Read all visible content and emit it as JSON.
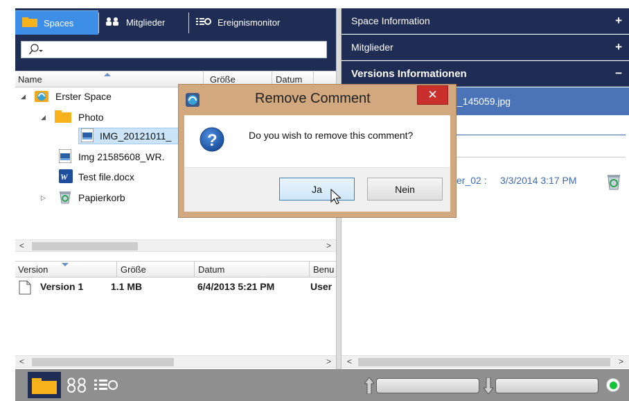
{
  "left_tabs": [
    {
      "label": "Spaces",
      "icon": "folder-icon",
      "active": true
    },
    {
      "label": "Mitglieder",
      "icon": "members-icon",
      "active": false
    },
    {
      "label": "Ereignismonitor",
      "icon": "event-monitor-icon",
      "active": false
    }
  ],
  "search": {
    "placeholder": "",
    "icon": "search-icon"
  },
  "file_columns": [
    "Name",
    "Größe",
    "Datum"
  ],
  "tree": [
    {
      "label": "Erster Space",
      "icon": "space-icon",
      "expanded": true
    },
    {
      "label": "Photo",
      "icon": "folder-icon",
      "expanded": true
    },
    {
      "label": "IMG_20121011_",
      "icon": "image-file-icon",
      "selected": true
    },
    {
      "label": "Img 21585608_WR.",
      "icon": "image-file-icon"
    },
    {
      "label": "Test file.docx",
      "icon": "word-file-icon"
    },
    {
      "label": "Papierkorb",
      "icon": "recycle-bin-icon",
      "expanded": false
    }
  ],
  "version_columns": [
    "Version",
    "Größe",
    "Datum",
    "Benu"
  ],
  "versions": [
    {
      "version": "Version 1",
      "size": "1.1 MB",
      "date": "6/4/2013 5:21 PM",
      "user": "User"
    }
  ],
  "right_panel": {
    "sections": [
      {
        "label": "Space Information",
        "toggle": "+"
      },
      {
        "label": "Mitglieder",
        "toggle": "+"
      },
      {
        "label": "Versions Informationen",
        "toggle": "−"
      }
    ],
    "selected_file": "_145059.jpg",
    "comment": {
      "author": "er_02 :",
      "date": "3/3/2014 3:17 PM"
    }
  },
  "dialog": {
    "title": "Remove Comment",
    "message": "Do you wish to remove this comment?",
    "yes_label": "Ja",
    "no_label": "Nein",
    "close_label": "✕"
  },
  "colors": {
    "navy": "#1f2d54",
    "tab_active": "#3d8ee6",
    "dialog_frame": "#d2a97e",
    "status_online": "#17c23a"
  }
}
